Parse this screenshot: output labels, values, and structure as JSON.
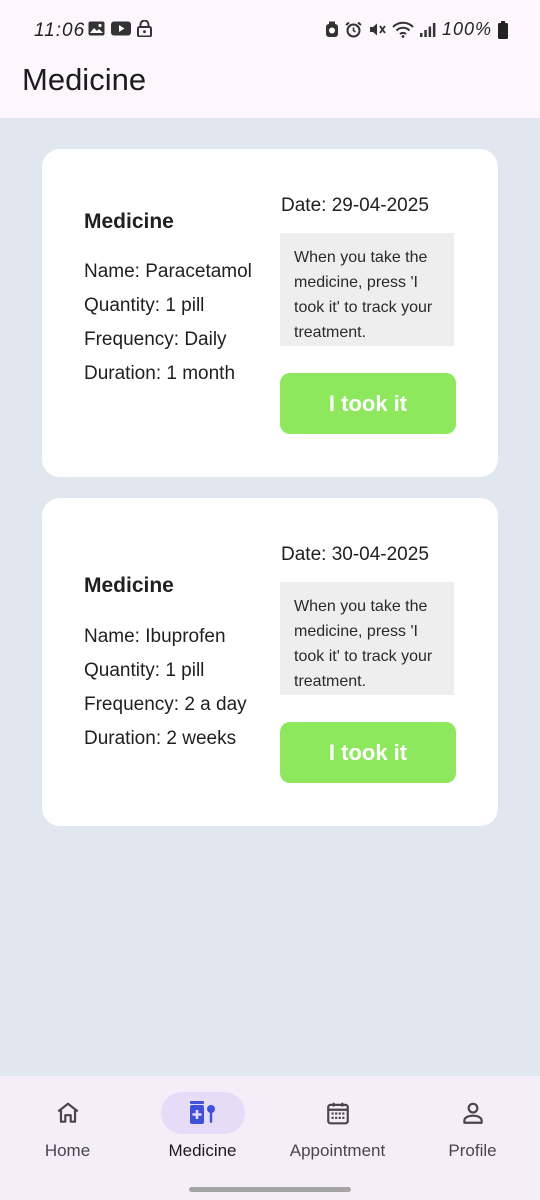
{
  "status_bar": {
    "time": "11:06",
    "battery": "100%"
  },
  "app_bar": {
    "title": "Medicine"
  },
  "medicines": [
    {
      "heading": "Medicine",
      "name": "Name: Paracetamol",
      "quantity": "Quantity: 1 pill",
      "frequency": "Frequency: Daily",
      "duration": "Duration: 1 month",
      "date": "Date: 29-04-2025",
      "note": "When you take the medicine, press 'I took it' to track your treatment.",
      "button_label": "I took it"
    },
    {
      "heading": "Medicine",
      "name": "Name: Ibuprofen",
      "quantity": "Quantity: 1 pill",
      "frequency": "Frequency: 2 a day",
      "duration": "Duration: 2 weeks",
      "date": "Date: 30-04-2025",
      "note": "When you take the medicine, press 'I took it' to track your treatment.",
      "button_label": "I took it"
    }
  ],
  "nav": {
    "items": [
      {
        "label": "Home",
        "icon": "home-icon"
      },
      {
        "label": "Medicine",
        "icon": "medicine-icon",
        "active": true
      },
      {
        "label": "Appointment",
        "icon": "calendar-icon"
      },
      {
        "label": "Profile",
        "icon": "person-icon"
      }
    ]
  },
  "colors": {
    "accent_green": "#8ee85e",
    "background": "#e0e7ef",
    "active_pill": "#e6dcf8",
    "medicine_icon": "#3f51d8"
  }
}
